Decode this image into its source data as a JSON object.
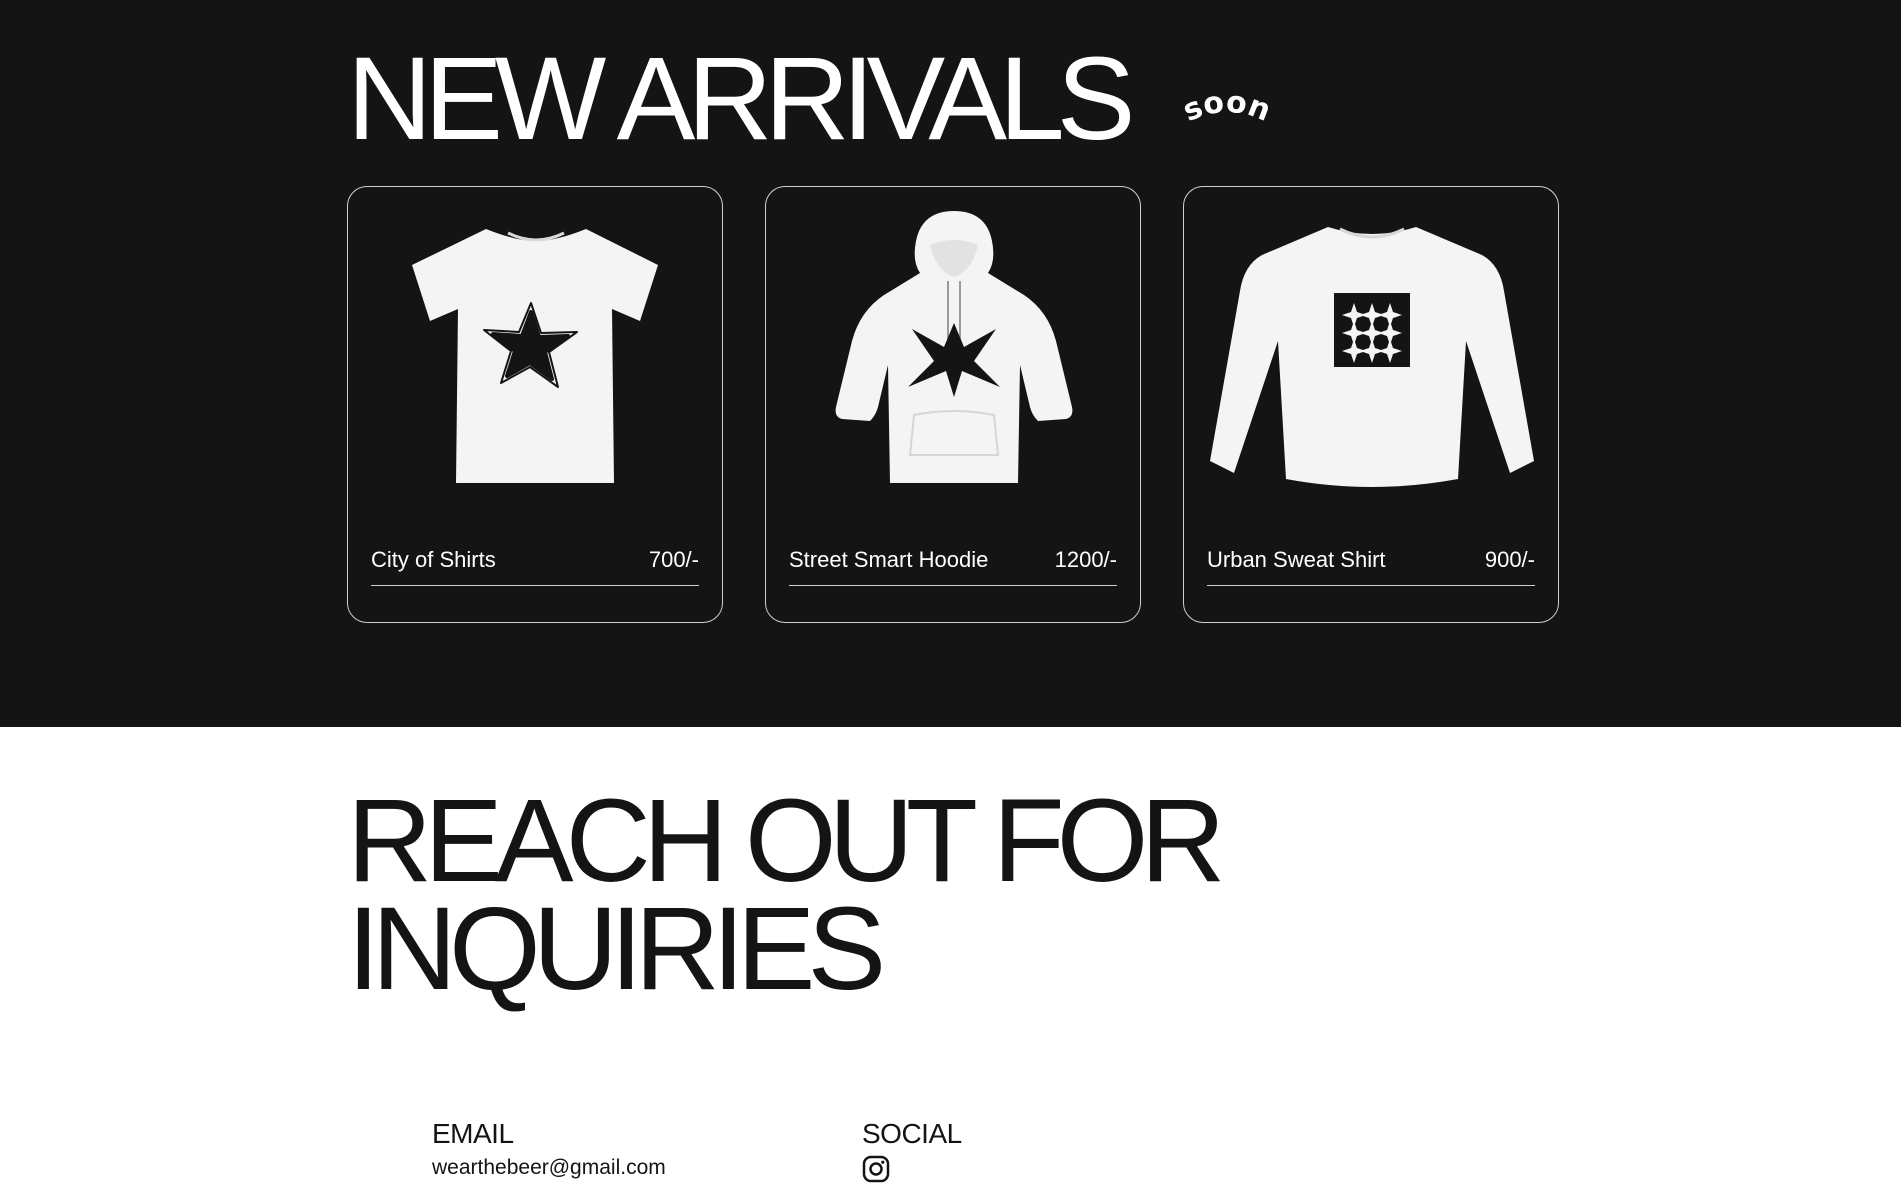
{
  "arrivals": {
    "title": "NEW ARRIVALS",
    "badge": "soon",
    "products": [
      {
        "name": "City of Shirts",
        "price": "700/-",
        "image_icon": "tshirt-star-print"
      },
      {
        "name": "Street Smart Hoodie",
        "price": "1200/-",
        "image_icon": "hoodie-burst-print"
      },
      {
        "name": "Urban Sweat Shirt",
        "price": "900/-",
        "image_icon": "sweatshirt-grid-print"
      }
    ]
  },
  "contact": {
    "title_line1": "REACH OUT FOR",
    "title_line2": "INQUIRIES",
    "email_heading": "EMAIL",
    "email_value": "wearthebeer@gmail.com",
    "social_heading": "SOCIAL",
    "social_icon": "instagram-icon"
  },
  "colors": {
    "dark_background": "#141414",
    "light_background": "#ffffff",
    "card_border": "#cfcfcf"
  }
}
